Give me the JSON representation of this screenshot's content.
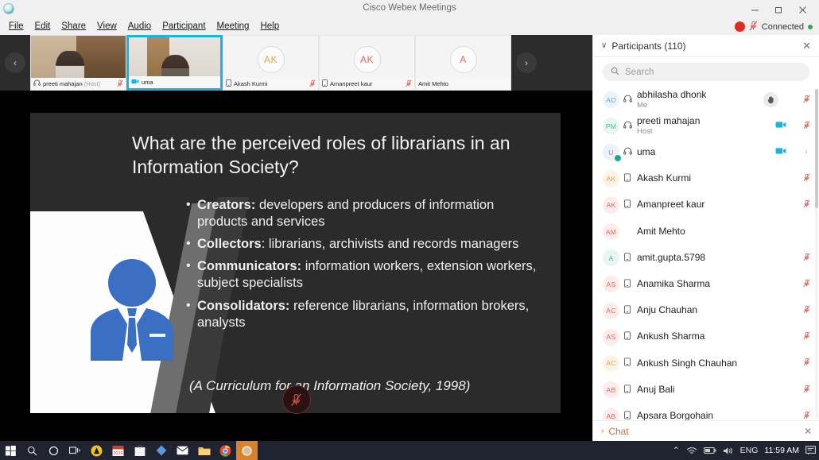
{
  "window": {
    "title": "Cisco Webex Meetings",
    "minimize": "–",
    "maximize": "❐",
    "close": "✕"
  },
  "menu": {
    "items": [
      "File",
      "Edit",
      "Share",
      "View",
      "Audio",
      "Participant",
      "Meeting",
      "Help"
    ]
  },
  "status": {
    "recording_glyph": "●",
    "mic_muted_glyph": "ᴊ",
    "text": "Connected"
  },
  "filmstrip": {
    "prev_glyph": "‹",
    "next_glyph": "›",
    "thumbs": [
      {
        "name": "preeti mahajan",
        "role": "(Host)",
        "device": "headset",
        "muted": true,
        "video": true,
        "active": false,
        "initials": "",
        "initials_color": ""
      },
      {
        "name": "uma",
        "role": "",
        "device": "video",
        "muted": false,
        "video": true,
        "active": true,
        "initials": "",
        "initials_color": ""
      },
      {
        "name": "Akash Kurmi",
        "role": "",
        "device": "phone",
        "muted": true,
        "video": false,
        "active": false,
        "initials": "AK",
        "initials_color": "#e8a33d"
      },
      {
        "name": "Amanpreet kaur",
        "role": "",
        "device": "phone",
        "muted": true,
        "video": false,
        "active": false,
        "initials": "AK",
        "initials_color": "#e2685e"
      },
      {
        "name": "Amit Mehto",
        "role": "",
        "device": "none",
        "muted": false,
        "video": false,
        "active": false,
        "initials": "A",
        "initials_color": "#e2685e"
      }
    ]
  },
  "slide": {
    "title": "What are the perceived roles of librarians in an Information Society?",
    "bullets": [
      {
        "lead": "Creators:",
        "rest": " developers and producers of information products and services"
      },
      {
        "lead": "Collectors",
        "rest": ": librarians, archivists and records managers"
      },
      {
        "lead": "Communicators:",
        "rest": " information workers, extension workers, subject specialists"
      },
      {
        "lead": "Consolidators:",
        "rest": " reference librarians, information brokers, analysts"
      }
    ],
    "citation": "(A Curriculum for an Information Society, 1998)",
    "mic_glyph": "ᴊ"
  },
  "panel": {
    "collapse_glyph": "∨",
    "title": "Participants (110)",
    "close_glyph": "✕",
    "search": {
      "icon": "⌕",
      "placeholder": "Search",
      "value": ""
    },
    "participants": [
      {
        "initials": "AD",
        "color": "#5aa9d6",
        "bg": "#eaf4fa",
        "name": "abhilasha dhonk",
        "role": "Me",
        "device": "headset",
        "hand": true,
        "video": false,
        "muted": true,
        "chevron": false
      },
      {
        "initials": "PM",
        "color": "#49b8a4",
        "bg": "#e7f6f3",
        "name": "preeti mahajan",
        "role": "Host",
        "device": "headset",
        "hand": false,
        "video": true,
        "muted": true,
        "chevron": false
      },
      {
        "initials": "U",
        "color": "#7d9bb5",
        "bg": "#eef1f5",
        "name": "uma",
        "role": "",
        "device": "headset",
        "hand": false,
        "video": true,
        "muted": false,
        "chevron": true,
        "speaking": true
      },
      {
        "initials": "AK",
        "color": "#e8a33d",
        "bg": "#fdf3e4",
        "name": "Akash Kurmi",
        "role": "",
        "device": "phone",
        "hand": false,
        "video": false,
        "muted": true,
        "chevron": false
      },
      {
        "initials": "AK",
        "color": "#e2685e",
        "bg": "#fdecea",
        "name": "Amanpreet kaur",
        "role": "",
        "device": "phone",
        "hand": false,
        "video": false,
        "muted": true,
        "chevron": false
      },
      {
        "initials": "AM",
        "color": "#e2685e",
        "bg": "#fdecea",
        "name": "Amit Mehto",
        "role": "",
        "device": "none",
        "hand": false,
        "video": false,
        "muted": false,
        "chevron": false
      },
      {
        "initials": "A",
        "color": "#49b8a4",
        "bg": "#e7f6f3",
        "name": "amit.gupta.5798",
        "role": "",
        "device": "phone",
        "hand": false,
        "video": false,
        "muted": true,
        "chevron": false
      },
      {
        "initials": "AS",
        "color": "#e2685e",
        "bg": "#fdecea",
        "name": "Anamika Sharma",
        "role": "",
        "device": "phone",
        "hand": false,
        "video": false,
        "muted": true,
        "chevron": false
      },
      {
        "initials": "AC",
        "color": "#e2685e",
        "bg": "#fdecea",
        "name": "Anju Chauhan",
        "role": "",
        "device": "phone",
        "hand": false,
        "video": false,
        "muted": true,
        "chevron": false
      },
      {
        "initials": "AS",
        "color": "#e2685e",
        "bg": "#fdecea",
        "name": "Ankush Sharma",
        "role": "",
        "device": "phone",
        "hand": false,
        "video": false,
        "muted": true,
        "chevron": false
      },
      {
        "initials": "AC",
        "color": "#e8a33d",
        "bg": "#fdf3e4",
        "name": "Ankush Singh Chauhan",
        "role": "",
        "device": "phone",
        "hand": false,
        "video": false,
        "muted": true,
        "chevron": false
      },
      {
        "initials": "AB",
        "color": "#e2685e",
        "bg": "#fdecea",
        "name": "Anuj Bali",
        "role": "",
        "device": "phone",
        "hand": false,
        "video": false,
        "muted": true,
        "chevron": false
      },
      {
        "initials": "AB",
        "color": "#e2685e",
        "bg": "#fdecea",
        "name": "Apsara Borgohain",
        "role": "",
        "device": "phone",
        "hand": false,
        "video": false,
        "muted": true,
        "chevron": false
      }
    ],
    "chat": {
      "expand_glyph": "›",
      "label": "Chat",
      "close_glyph": "✕"
    }
  },
  "taskbar": {
    "tray": {
      "up_glyph": "⌃",
      "language": "ENG",
      "time": "11:59 AM"
    }
  }
}
